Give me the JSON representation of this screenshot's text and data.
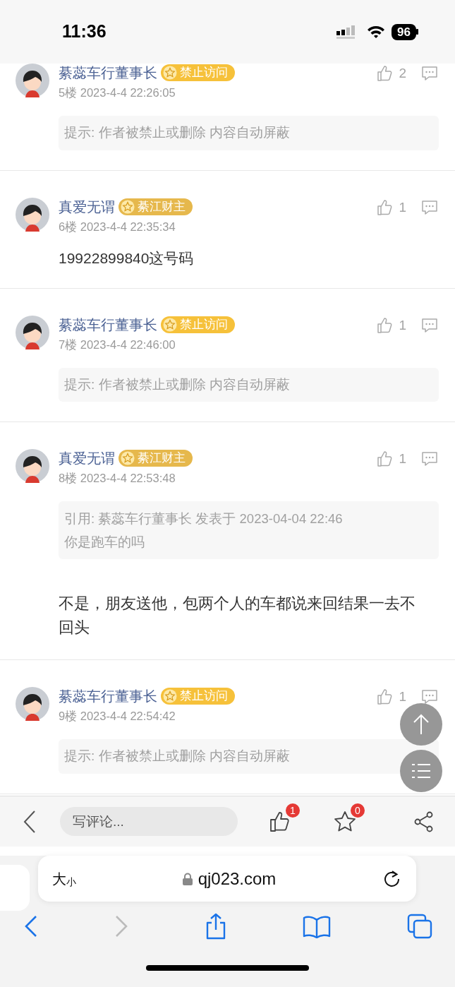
{
  "status_bar": {
    "time": "11:36",
    "battery": "96"
  },
  "posts": [
    {
      "author": "綦蕊车行董事长",
      "badge": {
        "label": "禁止访问",
        "color": "#f6c13a"
      },
      "floor_time": "5楼 2023-4-4 22:26:05",
      "likes": "2",
      "content": [
        {
          "kind": "notice",
          "text": "提示: 作者被禁止或删除 内容自动屏蔽"
        }
      ]
    },
    {
      "author": "真爱无谓",
      "badge": {
        "label": "綦江财主",
        "color": "#e6b84c"
      },
      "floor_time": "6楼 2023-4-4 22:35:34",
      "likes": "1",
      "content": [
        {
          "kind": "text",
          "text": "19922899840这号码"
        }
      ]
    },
    {
      "author": "綦蕊车行董事长",
      "badge": {
        "label": "禁止访问",
        "color": "#f6c13a"
      },
      "floor_time": "7楼 2023-4-4 22:46:00",
      "likes": "1",
      "content": [
        {
          "kind": "notice",
          "text": "提示: 作者被禁止或删除 内容自动屏蔽"
        }
      ]
    },
    {
      "author": "真爱无谓",
      "badge": {
        "label": "綦江财主",
        "color": "#e6b84c"
      },
      "floor_time": "8楼 2023-4-4 22:53:48",
      "likes": "1",
      "content": [
        {
          "kind": "quote",
          "lines": [
            "引用: 綦蕊车行董事长 发表于 2023-04-04 22:46",
            "你是跑车的吗"
          ]
        },
        {
          "kind": "reply",
          "text": "不是，朋友送他，包两个人的车都说来回结果一去不回头"
        }
      ]
    },
    {
      "author": "綦蕊车行董事长",
      "badge": {
        "label": "禁止访问",
        "color": "#f6c13a"
      },
      "floor_time": "9楼 2023-4-4 22:54:42",
      "likes": "1",
      "content": [
        {
          "kind": "notice",
          "text": "提示: 作者被禁止或删除 内容自动屏蔽"
        }
      ]
    }
  ],
  "comment_bar": {
    "placeholder": "写评论...",
    "like_count": "1",
    "favorite_count": "0"
  },
  "browser": {
    "text_size_large": "大",
    "text_size_small": "小",
    "url": "qj023.com"
  }
}
